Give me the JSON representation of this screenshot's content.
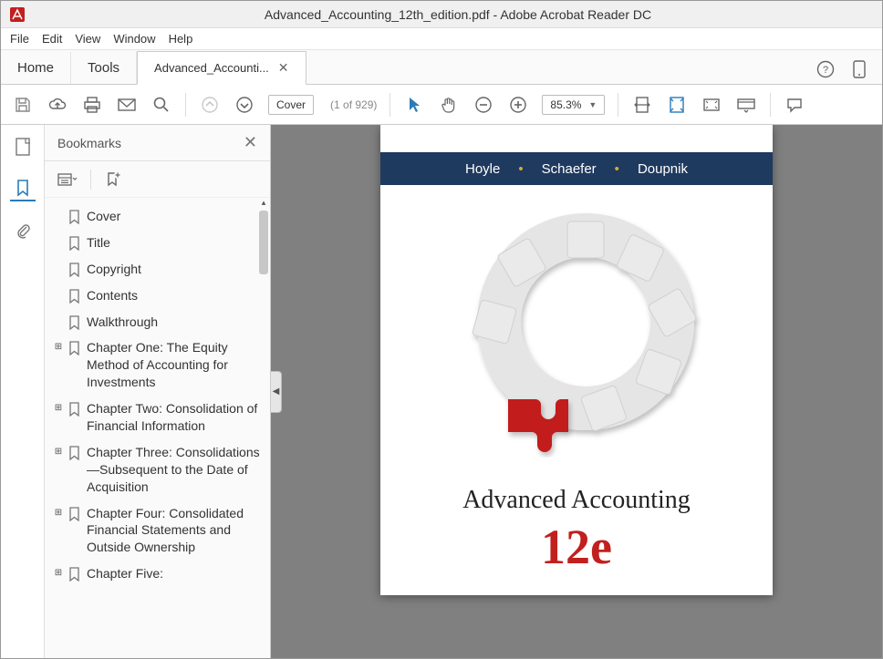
{
  "window": {
    "title": "Advanced_Accounting_12th_edition.pdf - Adobe Acrobat Reader DC"
  },
  "menu": {
    "items": [
      "File",
      "Edit",
      "View",
      "Window",
      "Help"
    ]
  },
  "tabs": {
    "home": "Home",
    "tools": "Tools",
    "doc_label": "Advanced_Accounti..."
  },
  "toolbar": {
    "page_label": "Cover",
    "page_info": "(1 of 929)",
    "zoom": "85.3%"
  },
  "sidebar": {
    "title": "Bookmarks",
    "items": [
      {
        "label": "Cover",
        "expandable": false
      },
      {
        "label": "Title",
        "expandable": false
      },
      {
        "label": "Copyright",
        "expandable": false
      },
      {
        "label": "Contents",
        "expandable": false
      },
      {
        "label": "Walkthrough",
        "expandable": false
      },
      {
        "label": "Chapter One: The Equity Method of Accounting for Investments",
        "expandable": true
      },
      {
        "label": "Chapter Two: Consolidation of Financial Information",
        "expandable": true
      },
      {
        "label": "Chapter Three: Consolidations—Subsequent to the Date of Acquisition",
        "expandable": true
      },
      {
        "label": "Chapter Four: Consolidated Financial Statements and Outside Ownership",
        "expandable": true
      },
      {
        "label": "Chapter Five:",
        "expandable": true
      }
    ]
  },
  "page": {
    "authors": [
      "Hoyle",
      "Schaefer",
      "Doupnik"
    ],
    "book_title": "Advanced Accounting",
    "edition": "12e"
  }
}
